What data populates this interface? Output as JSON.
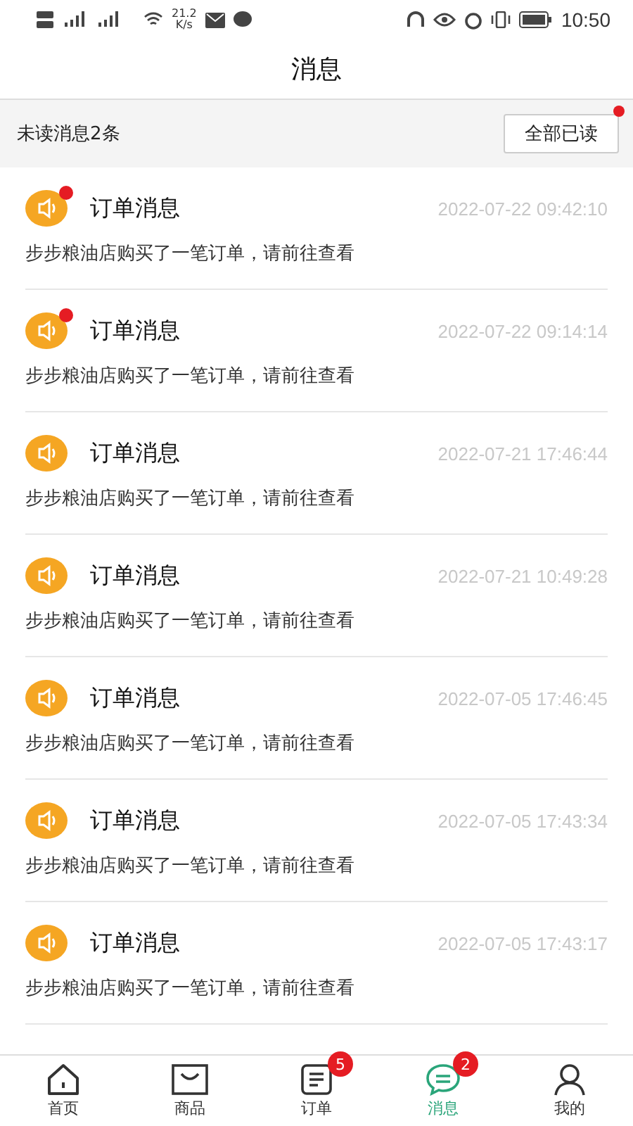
{
  "status_bar": {
    "speed": "21.2",
    "speed_unit": "K/s",
    "time": "10:50"
  },
  "header": {
    "title": "消息"
  },
  "unread_bar": {
    "label": "未读消息2条",
    "button": "全部已读",
    "button_dot": true
  },
  "messages": [
    {
      "title": "订单消息",
      "time": "2022-07-22 09:42:10",
      "body": "步步粮油店购买了一笔订单，请前往查看",
      "unread": true
    },
    {
      "title": "订单消息",
      "time": "2022-07-22 09:14:14",
      "body": "步步粮油店购买了一笔订单，请前往查看",
      "unread": true
    },
    {
      "title": "订单消息",
      "time": "2022-07-21 17:46:44",
      "body": "步步粮油店购买了一笔订单，请前往查看",
      "unread": false
    },
    {
      "title": "订单消息",
      "time": "2022-07-21 10:49:28",
      "body": "步步粮油店购买了一笔订单，请前往查看",
      "unread": false
    },
    {
      "title": "订单消息",
      "time": "2022-07-05 17:46:45",
      "body": "步步粮油店购买了一笔订单，请前往查看",
      "unread": false
    },
    {
      "title": "订单消息",
      "time": "2022-07-05 17:43:34",
      "body": "步步粮油店购买了一笔订单，请前往查看",
      "unread": false
    },
    {
      "title": "订单消息",
      "time": "2022-07-05 17:43:17",
      "body": "步步粮油店购买了一笔订单，请前往查看",
      "unread": false
    }
  ],
  "tab_bar": [
    {
      "kind": "home",
      "label": "首页",
      "selected": false
    },
    {
      "kind": "goods",
      "label": "商品",
      "selected": false
    },
    {
      "kind": "orders",
      "label": "订单",
      "selected": false,
      "badge": "5"
    },
    {
      "kind": "messages",
      "label": "消息",
      "selected": true,
      "badge": "2"
    },
    {
      "kind": "profile",
      "label": "我的",
      "selected": false
    }
  ]
}
